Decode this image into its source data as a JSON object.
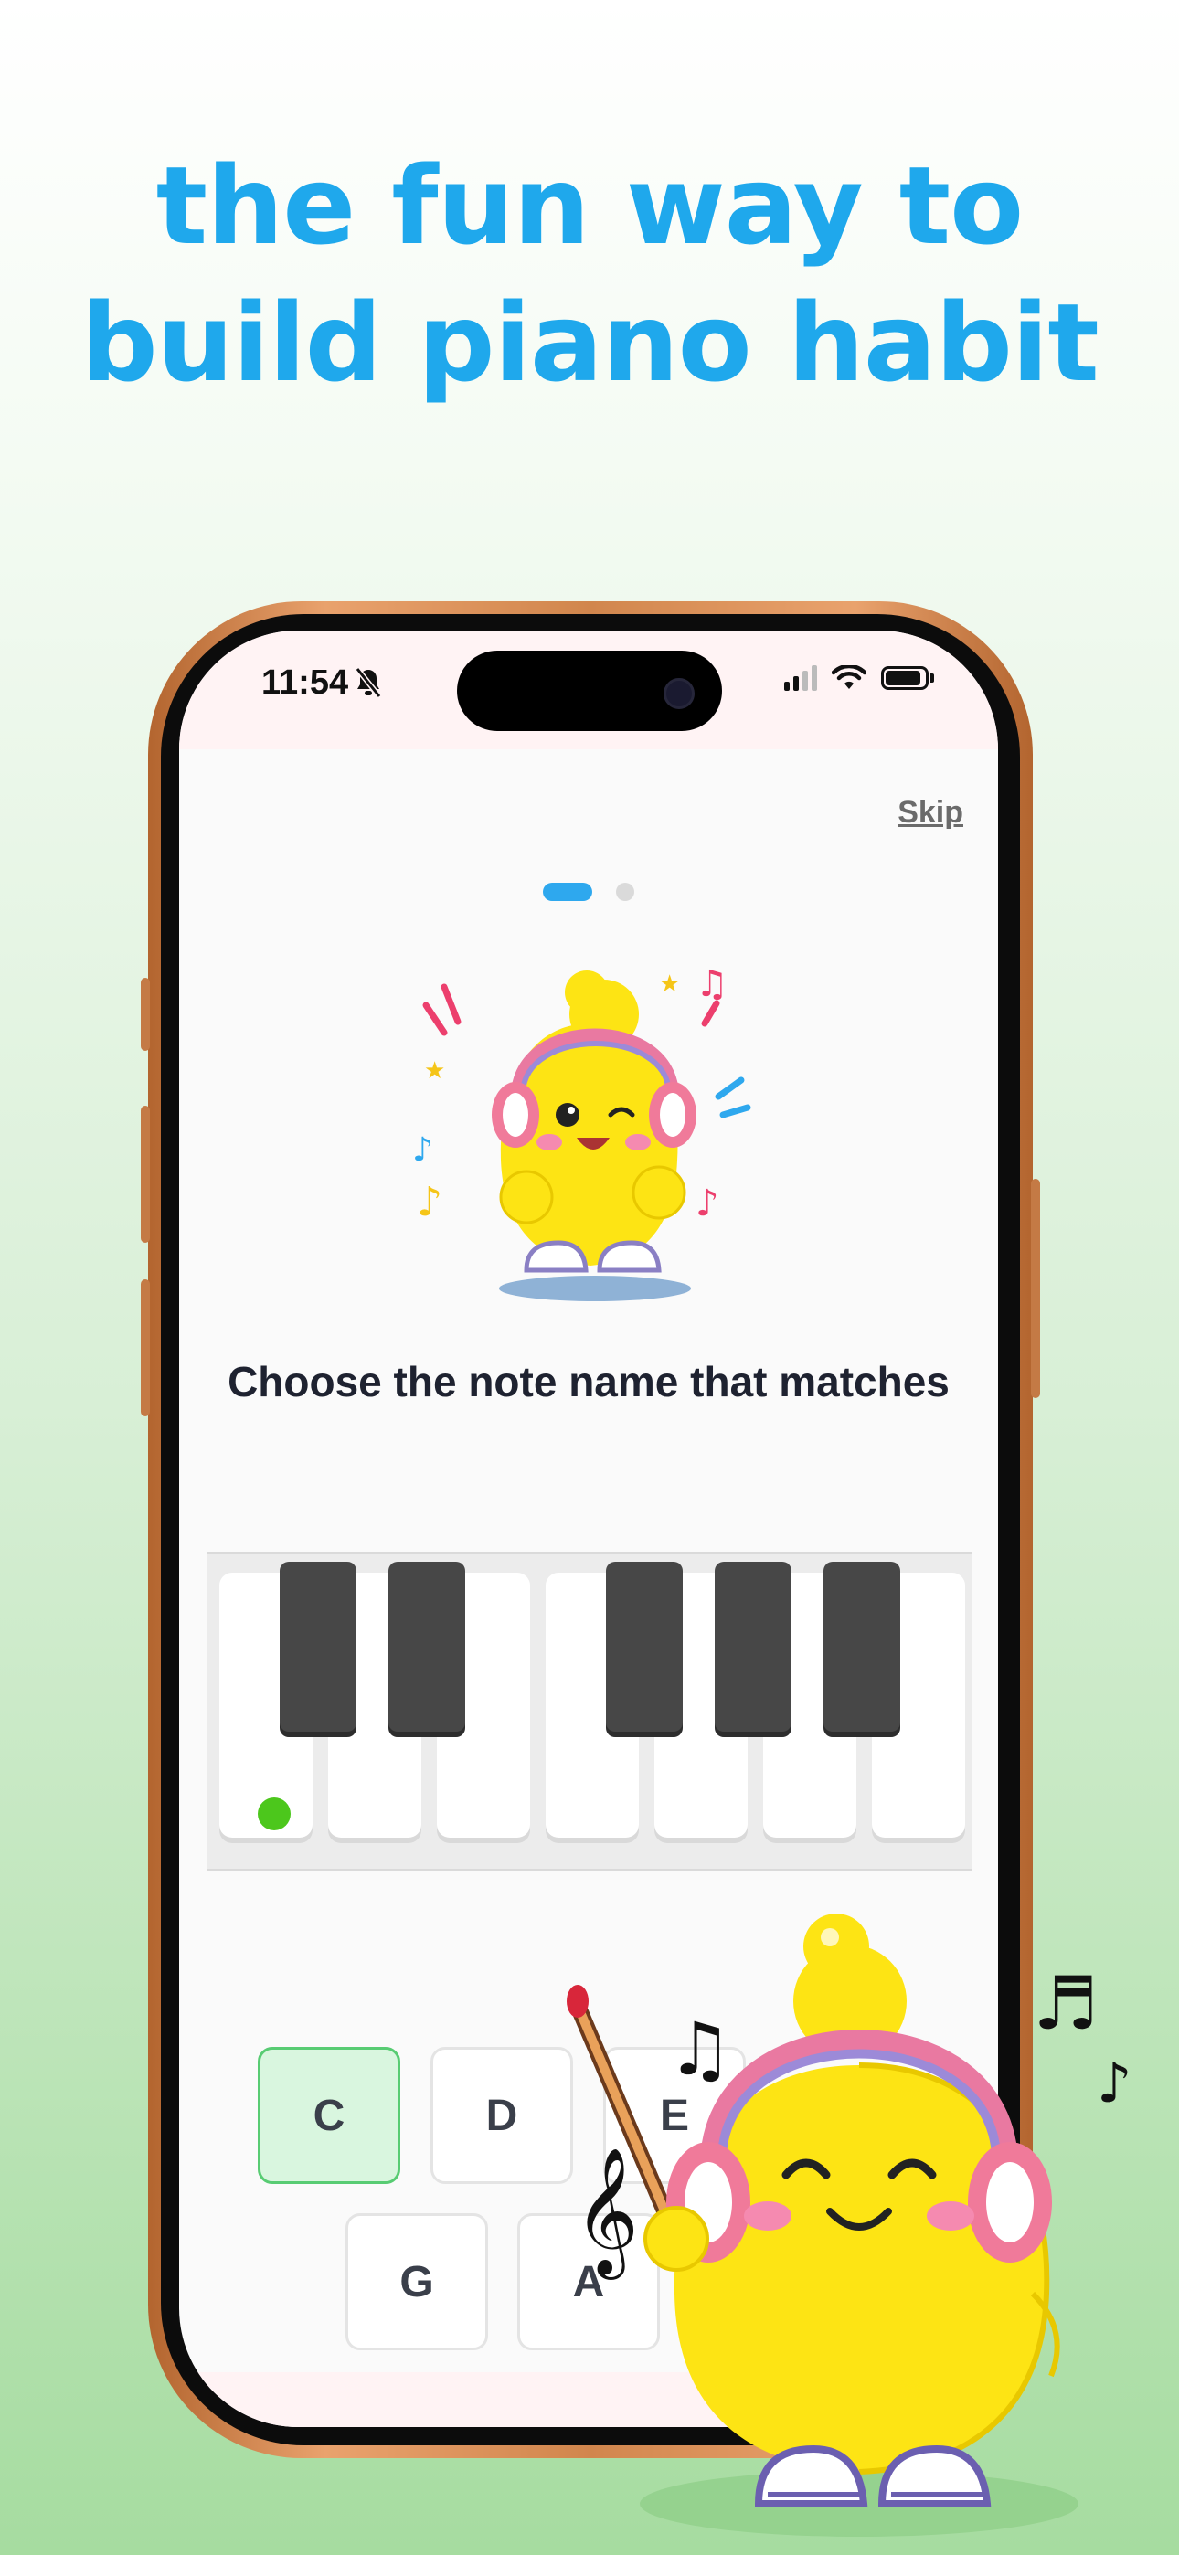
{
  "headline": {
    "line1": "the fun way to",
    "line2": "build piano habit"
  },
  "colors": {
    "headline": "#1fa8ec",
    "accent": "#2ea8ee",
    "selected_answer_bg": "#d9f6df",
    "selected_answer_border": "#58cc73",
    "marker_dot": "#4cc71c"
  },
  "status_bar": {
    "time": "11:54",
    "silent_icon": "bell-slash-icon",
    "icons": [
      "signal-icon",
      "wifi-icon",
      "battery-icon"
    ]
  },
  "onboarding": {
    "skip_label": "Skip",
    "page_indicator": {
      "current": 1,
      "total": 2
    },
    "question": "Choose the note name that matches"
  },
  "piano": {
    "white_keys": 7,
    "black_keys": 5,
    "marked_key_index": 0
  },
  "answers": {
    "row1": [
      "C",
      "D",
      "E"
    ],
    "row2": [
      "G",
      "A"
    ],
    "selected": "C"
  }
}
